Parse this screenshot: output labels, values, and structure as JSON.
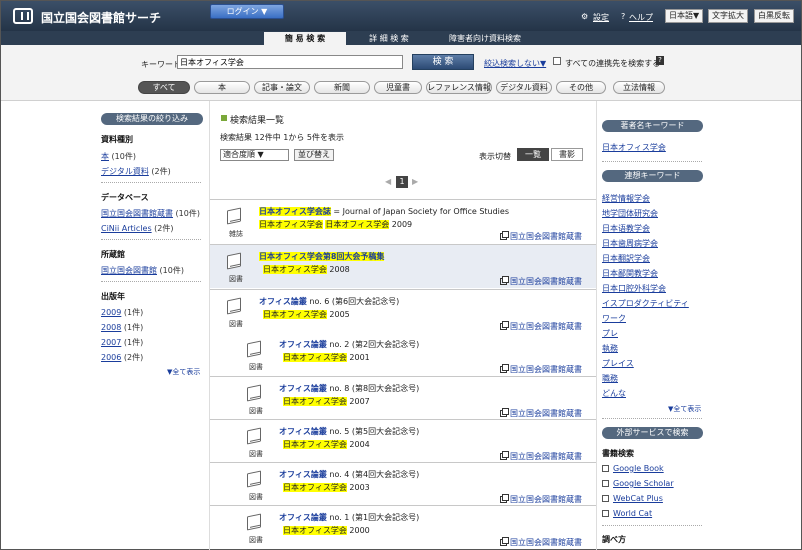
{
  "header": {
    "site_title": "国立国会図書館サーチ",
    "login": "ログイン ▼",
    "settings": "設定",
    "help": "ヘルプ",
    "language": "日本語▼",
    "zoom": "文字拡大",
    "invert": "白黒反転"
  },
  "tabs": [
    {
      "label": "簡 易 検 索",
      "active": true
    },
    {
      "label": "詳 細 検 索",
      "active": false
    },
    {
      "label": "障害者向け資料検索",
      "active": false
    }
  ],
  "search": {
    "keyword_label": "キーワード",
    "keyword_value": "日本オフィス学会",
    "button": "検 索",
    "filter_link": "絞込検索しない▼",
    "checkbox_label": "すべての連携先を検索する",
    "help_icon": "?"
  },
  "categories": [
    "すべて",
    "本",
    "記事・論文",
    "新聞",
    "児童書",
    "レファレンス情報",
    "デジタル資料",
    "その他",
    "立法情報"
  ],
  "left": {
    "narrow_head": "検索結果の絞り込み",
    "sections": [
      {
        "head": "資料種別",
        "items": [
          {
            "label": "本",
            "count": "(10件)"
          },
          {
            "label": "デジタル資料",
            "count": "(2件)"
          }
        ]
      },
      {
        "head": "データベース",
        "items": [
          {
            "label": "国立国会図書館蔵書",
            "count": "(10件)"
          },
          {
            "label": "CiNii Articles",
            "count": "(2件)"
          }
        ]
      },
      {
        "head": "所蔵館",
        "items": [
          {
            "label": "国立国会図書館",
            "count": "(10件)"
          }
        ]
      },
      {
        "head": "出版年",
        "items": [
          {
            "label": "2009",
            "count": "(1件)"
          },
          {
            "label": "2008",
            "count": "(1件)"
          },
          {
            "label": "2007",
            "count": "(1件)"
          },
          {
            "label": "2006",
            "count": "(2件)"
          }
        ]
      }
    ],
    "show_all": "▼全て表示"
  },
  "main": {
    "title": "検索結果一覧",
    "count": "検索結果 12件中 1から 5件を表示",
    "sort": "適合度順 ▼",
    "sort_button": "並び替え",
    "view_label": "表示切替",
    "view_list": "一覧",
    "view_cover": "書影",
    "page": "1",
    "prev": "◀",
    "next": "▶",
    "results": [
      {
        "type": "雑誌",
        "title_hl": "日本オフィス学会誌",
        "title_rest": " = Journal of Japan Society for Office Studies",
        "author": "日本オフィス学会",
        "author2": "日本オフィス学会",
        "year": "2009",
        "lib": "国立国会図書館蔵書"
      },
      {
        "type": "図書",
        "title_hl": "日本オフィス学会第8回大会予稿集",
        "title_rest": "",
        "author": "日本オフィス学会",
        "author2": "",
        "year": "2008",
        "lib": "国立国会図書館蔵書"
      },
      {
        "type": "図書",
        "title_hl": "オフィス論叢",
        "title_rest": " no. 6 (第6回大会記念号)",
        "author": "日本オフィス学会",
        "author2": "",
        "year": "2005",
        "lib": "国立国会図書館蔵書"
      },
      {
        "type": "図書",
        "title_hl": "オフィス論叢",
        "title_rest": " no. 2 (第2回大会記念号)",
        "author": "日本オフィス学会",
        "author2": "",
        "year": "2001",
        "lib": "国立国会図書館蔵書"
      },
      {
        "type": "図書",
        "title_hl": "オフィス論叢",
        "title_rest": " no. 8 (第8回大会記念号)",
        "author": "日本オフィス学会",
        "author2": "",
        "year": "2007",
        "lib": "国立国会図書館蔵書"
      },
      {
        "type": "図書",
        "title_hl": "オフィス論叢",
        "title_rest": " no. 5 (第5回大会記念号)",
        "author": "日本オフィス学会",
        "author2": "",
        "year": "2004",
        "lib": "国立国会図書館蔵書"
      },
      {
        "type": "図書",
        "title_hl": "オフィス論叢",
        "title_rest": " no. 4 (第4回大会記念号)",
        "author": "日本オフィス学会",
        "author2": "",
        "year": "2003",
        "lib": "国立国会図書館蔵書"
      },
      {
        "type": "図書",
        "title_hl": "オフィス論叢",
        "title_rest": " no. 1 (第1回大会記念号)",
        "author": "日本オフィス学会",
        "author2": "",
        "year": "2000",
        "lib": "国立国会図書館蔵書"
      }
    ]
  },
  "right": {
    "author_head": "著者名キーワード",
    "author_item": "日本オフィス学会",
    "assoc_head": "連想キーワード",
    "assoc_items": [
      "経営情報学会",
      "地学団体研究会",
      "日本语教学会",
      "日本歯周病学会",
      "日本翻訳学会",
      "日本鄙関教学会",
      "日本口腔外科学会",
      "イスプロダクティビティ",
      "ワーク",
      "プレ",
      "執務",
      "プレイス",
      "職務",
      "どんな"
    ],
    "show_all": "▼全て表示",
    "ext_head": "外部サービスで検索",
    "book_search": "書籍検索",
    "ext_items": [
      "Google Book",
      "Google Scholar",
      "WebCat Plus",
      "World Cat"
    ],
    "more_head": "調べ方"
  }
}
